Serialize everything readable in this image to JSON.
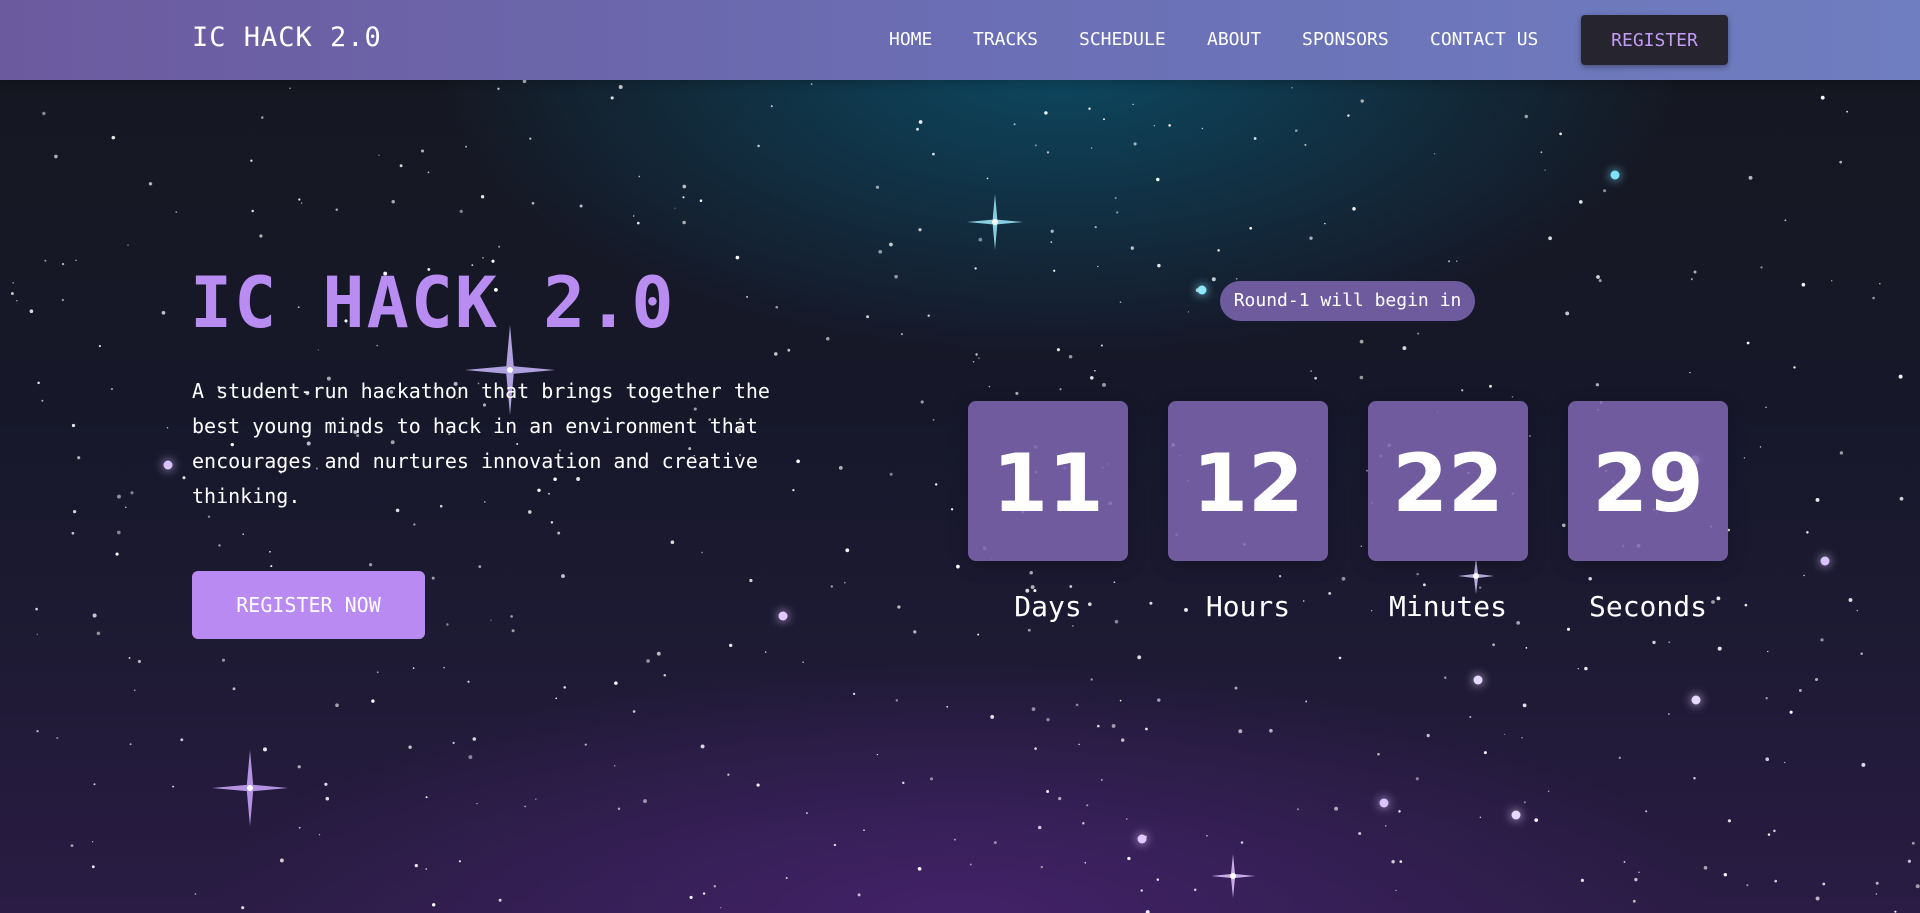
{
  "navbar": {
    "brand": "IC HACK 2.0",
    "links": [
      {
        "label": "HOME"
      },
      {
        "label": "TRACKS"
      },
      {
        "label": "SCHEDULE"
      },
      {
        "label": "ABOUT"
      },
      {
        "label": "SPONSORS"
      },
      {
        "label": "CONTACT US"
      }
    ],
    "register_label": "REGISTER"
  },
  "hero": {
    "title": "IC HACK 2.0",
    "description": "A student-run hackathon that brings together the best young minds to hack in an environment that encourages and nurtures innovation and creative thinking.",
    "register_label": "REGISTER NOW"
  },
  "countdown": {
    "caption": "Round-1 will begin in",
    "units": [
      {
        "value": "11",
        "label": "Days"
      },
      {
        "value": "12",
        "label": "Hours"
      },
      {
        "value": "22",
        "label": "Minutes"
      },
      {
        "value": "29",
        "label": "Seconds"
      }
    ]
  },
  "colors": {
    "navbar_start": "#6c5a9e",
    "navbar_end": "#6f7ec0",
    "accent_purple": "#b88cf0",
    "register_button_bg": "#25242f",
    "register_button_text": "#c49cf5",
    "countdown_box": "#7c64ae",
    "round_pill": "#6e5b9e"
  }
}
